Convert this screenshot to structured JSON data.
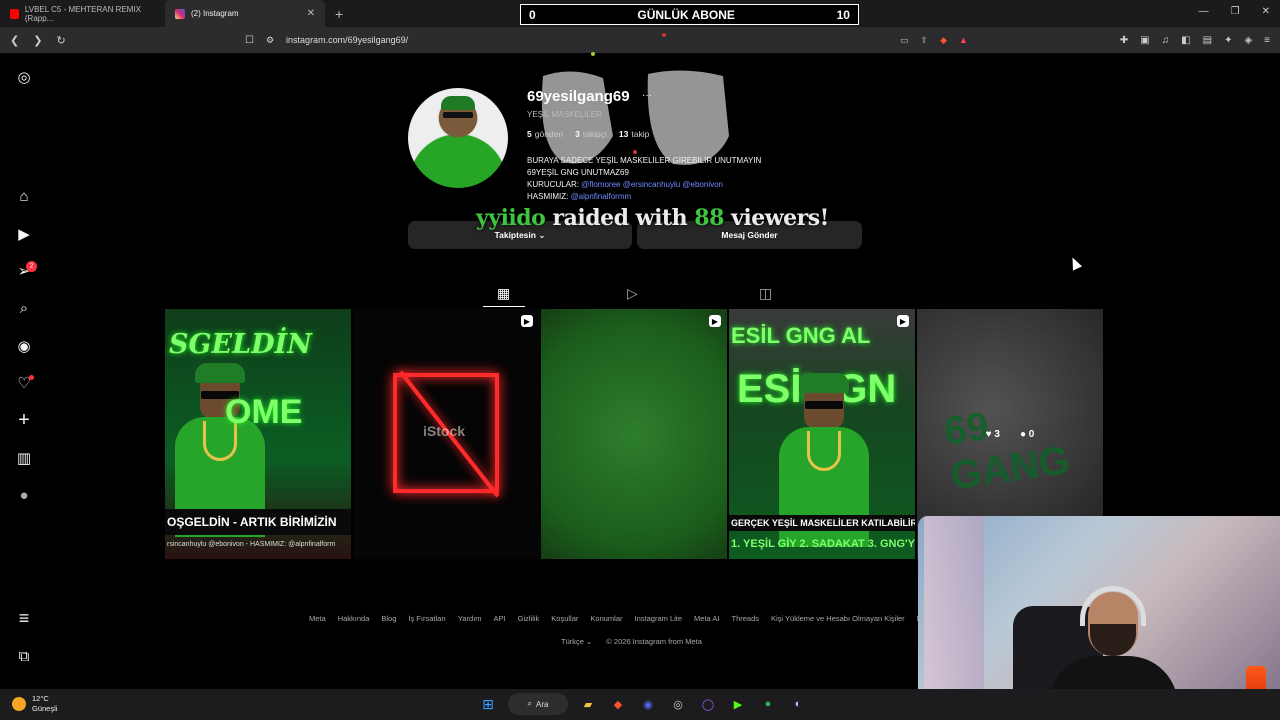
{
  "browser": {
    "tabs": [
      {
        "label": "LVBEL C5 - MEHTERAN REMIX (Rapp...",
        "active": false,
        "favicon_color": "#ff0000"
      },
      {
        "label": "(2) Instagram",
        "active": true,
        "favicon_color": "#d6249f"
      }
    ],
    "url": "instagram.com/69yesilgang69/"
  },
  "overlay_banner": {
    "left": "0",
    "title": "GÜNLÜK ABONE",
    "right": "10"
  },
  "sidebar": {
    "items": [
      {
        "name": "instagram-logo-icon",
        "glyph": "◎"
      },
      {
        "name": "home-icon",
        "glyph": "⌂"
      },
      {
        "name": "reels-icon",
        "glyph": "▶"
      },
      {
        "name": "messages-icon",
        "glyph": "➢",
        "badge": "2"
      },
      {
        "name": "search-icon",
        "glyph": "⌕"
      },
      {
        "name": "explore-icon",
        "glyph": "◉"
      },
      {
        "name": "notifications-icon",
        "glyph": "♡"
      },
      {
        "name": "create-icon",
        "glyph": "+"
      },
      {
        "name": "dashboard-icon",
        "glyph": "▥"
      },
      {
        "name": "profile-avatar-icon",
        "glyph": "●"
      },
      {
        "name": "menu-icon",
        "glyph": "≡"
      },
      {
        "name": "also-from-meta-icon",
        "glyph": "⧉"
      }
    ]
  },
  "profile": {
    "username": "69yesilgang69",
    "more": "···",
    "full_name": "YEŞİL MASKELİLER",
    "stats": {
      "posts_count": "5",
      "posts_label": "gönderi",
      "followers_count": "3",
      "followers_label": "takipçi",
      "following_count": "13",
      "following_label": "takip"
    },
    "bio_line1": "BURAYA SADECE YEŞİL MASKELİLER GİREBİLİR UNUTMAYIN",
    "bio_line2": "69YEŞİL GNG UNUTMAZ69",
    "bio_line3_prefix": "KURUCULAR: ",
    "bio_line3_links": "@flomoree @ersincanhuylu @ebonivon",
    "bio_line4_prefix": "HASMIMIZ: ",
    "bio_line4_link": "@alpnfinalformm",
    "follow_button": "Takiptesin ⌄",
    "message_button": "Mesaj Gönder"
  },
  "raid_overlay": {
    "user": "yyiido",
    "text1": "raided with",
    "count": "88",
    "text2": "viewers!"
  },
  "profile_tabs": [
    {
      "name": "posts",
      "glyph": "▦",
      "active": true
    },
    {
      "name": "reels",
      "glyph": "▷",
      "active": false
    },
    {
      "name": "tagged",
      "glyph": "◫",
      "active": false
    }
  ],
  "posts": [
    {
      "headline": "SGELDİN",
      "sub": "OME",
      "band": "OŞGELDİN - ARTIK BİRİMİZİN",
      "small": "rsincanhuylu @ebonivon - HASMIMIZ: @alpnfinalform",
      "reel": false
    },
    {
      "watermark": "iStock",
      "reel": true
    },
    {
      "reel": true
    },
    {
      "headline": "ESİL GNG AL",
      "sub": "ESİL GN",
      "band1": "GERÇEK YEŞİL MASKELİLER KATILABİLİR -",
      "band2": "1. YEŞİL GİY 2. SADAKAT 3. GNG'Y",
      "reel": true
    },
    {
      "graffiti": "69 GANG",
      "likes": "3",
      "comments": "0",
      "reel": false
    }
  ],
  "footer": {
    "links": [
      "Meta",
      "Hakkında",
      "Blog",
      "İş Fırsatları",
      "Yardım",
      "API",
      "Gizlilik",
      "Koşullar",
      "Konumlar",
      "Instagram Lite",
      "Meta AI",
      "Threads",
      "Kişi Yükleme ve Hesabı Olmayan Kişiler",
      "M"
    ],
    "language": "Türkçe ⌄",
    "copyright": "© 2026 Instagram from Meta"
  },
  "taskbar": {
    "weather_temp": "12°C",
    "weather_desc": "Güneşli",
    "search_label": "Ara"
  },
  "colors": {
    "accent_green": "#3fc43f",
    "link_blue": "#6f8bff",
    "badge_red": "#ff3040"
  }
}
